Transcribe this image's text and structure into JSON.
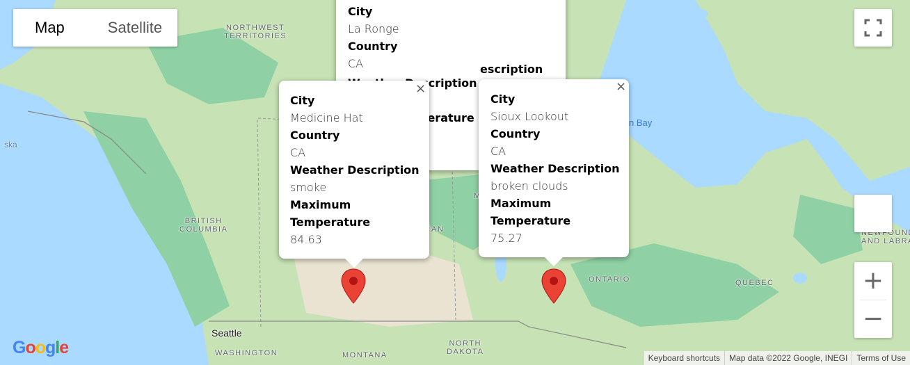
{
  "map": {
    "type_control": {
      "map_label": "Map",
      "satellite_label": "Satellite",
      "active": "Map"
    },
    "labels": {
      "northwest_territories": "NORTHWEST\nTERRITORIES",
      "alaska": "ska",
      "british_columbia": "BRITISH\nCOLUMBIA",
      "saskatchewan_fragment": "AN",
      "manitoba_fragment": "M",
      "ontario": "ONTARIO",
      "quebec": "QUEBEC",
      "newfoundland": "NEWFOUNDL\nAND LABRA",
      "hudson_bay": "n Bay",
      "seattle": "Seattle",
      "washington": "WASHINGTON",
      "montana": "MONTANA",
      "north_dakota": "NORTH\nDAKOTA"
    },
    "zoom_in_symbol": "+",
    "zoom_out_symbol": "−",
    "fullscreen_icon": "fullscreen-icon",
    "attribution": {
      "keyboard": "Keyboard shortcuts",
      "map_data": "Map data ©2022 Google, INEGI",
      "terms": "Terms of Use"
    },
    "google_logo": "Google",
    "colors": {
      "water": "#aadaff",
      "land": "#c7e3b5",
      "forest": "#8fd1a4",
      "marker": "#ea4335"
    }
  },
  "info_windows": {
    "la_ronge": {
      "city_label": "City",
      "city": "La Ronge",
      "country_label": "Country",
      "country": "CA",
      "weather_label_fragment": "escription",
      "weather_label_overlap": "Weather Description",
      "max_temp_fragment": "perature"
    },
    "medicine_hat": {
      "city_label": "City",
      "city": "Medicine Hat",
      "country_label": "Country",
      "country": "CA",
      "weather_label": "Weather Description",
      "weather": "smoke",
      "max_temp_label": "Maximum Temperature",
      "max_temp": "84.63"
    },
    "sioux_lookout": {
      "city_label": "City",
      "city": "Sioux Lookout",
      "country_label": "Country",
      "country": "CA",
      "weather_label": "Weather Description",
      "weather": "broken clouds",
      "max_temp_label": "Maximum Temperature",
      "max_temp": "75.27"
    },
    "close_symbol": "×"
  }
}
